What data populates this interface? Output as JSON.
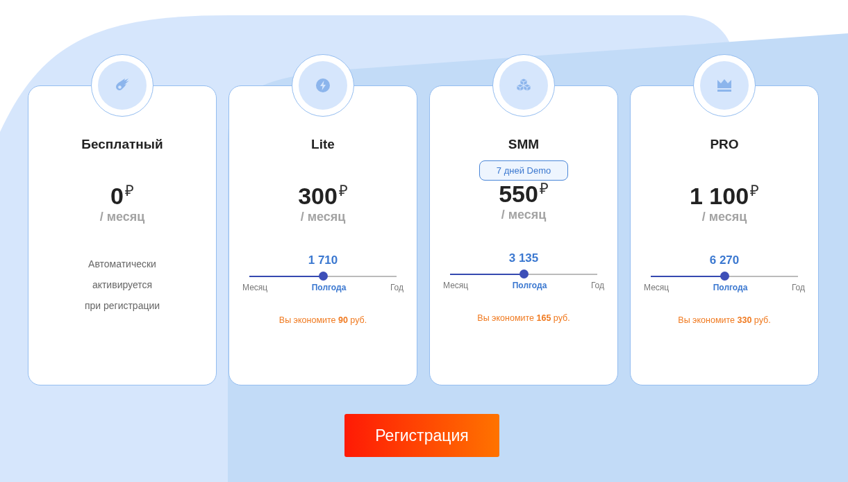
{
  "plans": [
    {
      "name": "Бесплатный",
      "price": "0",
      "currency": "₽",
      "period": "/ месяц",
      "note_lines": [
        "Автоматически",
        "активируется",
        "при регистрации"
      ]
    },
    {
      "name": "Lite",
      "price": "300",
      "currency": "₽",
      "period": "/ месяц",
      "slider": {
        "value": "1 710",
        "level": 0.5,
        "options": [
          {
            "label": "Месяц",
            "selected": false
          },
          {
            "label": "Полгода",
            "selected": true
          },
          {
            "label": "Год",
            "selected": false
          }
        ]
      },
      "savings": "Вы экономите **90** руб."
    },
    {
      "name": "SMM",
      "badge": "7 дней Demo",
      "price": "550",
      "currency": "₽",
      "period": "/ месяц",
      "slider": {
        "value": "3 135",
        "level": 0.5,
        "options": [
          {
            "label": "Месяц",
            "selected": false
          },
          {
            "label": "Полгода",
            "selected": true
          },
          {
            "label": "Год",
            "selected": false
          }
        ]
      },
      "savings": "Вы экономите **165** руб."
    },
    {
      "name": "PRO",
      "price": "1 100",
      "currency": "₽",
      "period": "/ месяц",
      "slider": {
        "value": "6 270",
        "level": 0.5,
        "options": [
          {
            "label": "Месяц",
            "selected": false
          },
          {
            "label": "Полгода",
            "selected": true
          },
          {
            "label": "Год",
            "selected": false
          }
        ]
      },
      "savings": "Вы экономите **330** руб."
    }
  ],
  "register_button": "Регистрация"
}
